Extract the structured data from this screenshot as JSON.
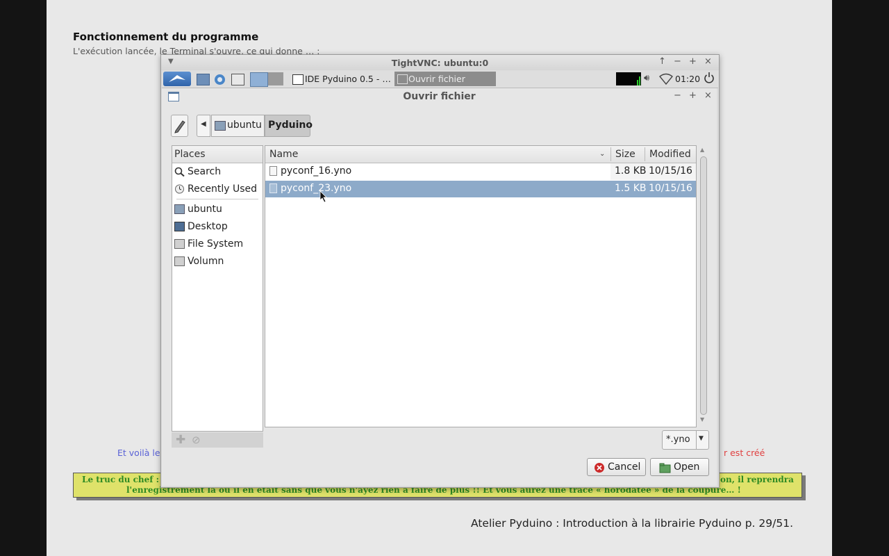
{
  "slide": {
    "title": "Fonctionnement du programme",
    "subtitle": "L'exécution lancée, le Terminal s'ouvre, ce qui donne …   :",
    "text_blue": "Et voilà le",
    "text_red": "r est créé",
    "tip_line1": "Le truc du chef :",
    "tip_line1_end": "on, il reprendra",
    "tip_line2": "l'enregistrement là où il en était sans que vous n'ayez rien à faire de plus !! Et vous aurez une trace « horodatée » de la coupure… !",
    "footer": "Atelier Pyduino : Introduction à la librairie Pyduino p. 29/51."
  },
  "vnc": {
    "title": "TightVNC: ubuntu:0",
    "controls": [
      "↑",
      "−",
      "+",
      "×"
    ]
  },
  "panel": {
    "task1": "IDE Pyduino 0.5 - …",
    "task2": "Ouvrir fichier",
    "clock": "01:20"
  },
  "dialog": {
    "title": "Ouvrir fichier",
    "controls": [
      "−",
      "+",
      "×"
    ],
    "breadcrumb": [
      "ubuntu",
      "Pyduino"
    ],
    "places_header": "Places",
    "places": [
      "Search",
      "Recently Used",
      "ubuntu",
      "Desktop",
      "File System",
      "Volumn"
    ],
    "columns": {
      "name": "Name",
      "size": "Size",
      "modified": "Modified"
    },
    "files": [
      {
        "name": "pyconf_16.yno",
        "size": "1.8 KB",
        "modified": "10/15/16",
        "selected": false
      },
      {
        "name": "pyconf_23.yno",
        "size": "1.5 KB",
        "modified": "10/15/16",
        "selected": true
      }
    ],
    "filter": "*.yno",
    "cancel_label": "Cancel",
    "open_label": "Open"
  },
  "colors": {
    "selection": "#8daac9",
    "tip_background": "#dfe26a",
    "tip_text": "#2e8a23",
    "cancel_icon": "#cc2a2a"
  }
}
